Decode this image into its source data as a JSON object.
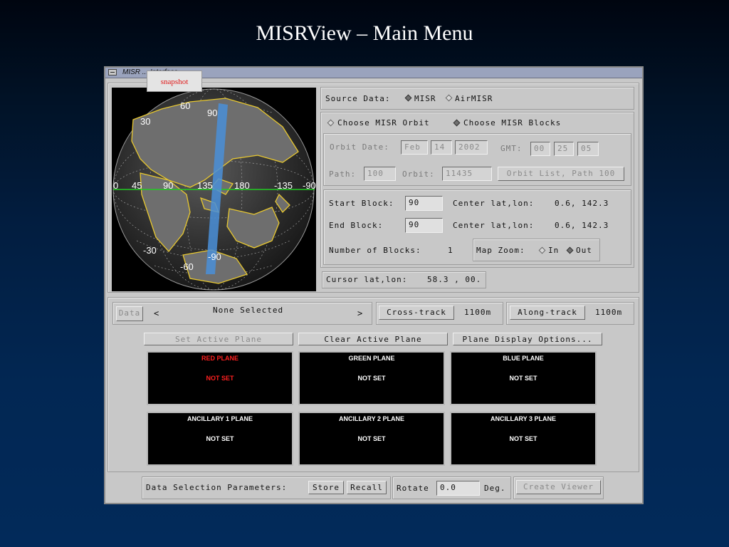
{
  "slide_title": "MISRView – Main Menu",
  "window": {
    "title": "MISR ... Interface",
    "snapshot_label": "snapshot"
  },
  "source_data": {
    "label": "Source Data:",
    "options": [
      "MISR",
      "AirMISR"
    ],
    "selected": "MISR"
  },
  "choose": {
    "orbit_label": "Choose MISR Orbit",
    "blocks_label": "Choose MISR Blocks",
    "selected": "blocks"
  },
  "orbit": {
    "date_label": "Orbit Date:",
    "month": "Feb",
    "day": "14",
    "year": "2002",
    "gmt_label": "GMT:",
    "gmt_h": "00",
    "gmt_m": "25",
    "gmt_s": "05",
    "path_label": "Path:",
    "path": "100",
    "orbit_label": "Orbit:",
    "orbit": "11435",
    "list_button": "Orbit List, Path 100"
  },
  "blocks": {
    "start_label": "Start Block:",
    "start": "90",
    "end_label": "End Block:",
    "end": "90",
    "center_label": "Center lat,lon:",
    "start_center": "0.6, 142.3",
    "end_center": "0.6, 142.3",
    "count_label": "Number of Blocks:",
    "count": "1"
  },
  "map_zoom": {
    "label": "Map Zoom:",
    "in": "In",
    "out": "Out",
    "selected": "out"
  },
  "cursor": {
    "label": "Cursor lat,lon:",
    "value": "58.3 , 00."
  },
  "globe": {
    "lat_labels": [
      "60",
      "30",
      "90",
      "-30",
      "-60",
      "-90"
    ],
    "lon_labels": [
      "0",
      "45",
      "90",
      "135",
      "180",
      "-135",
      "-90"
    ]
  },
  "data_bar": {
    "data_button": "Data",
    "prev": "<",
    "next": ">",
    "selection": "None Selected",
    "cross_track_button": "Cross-track",
    "cross_track_value": "1100m",
    "along_track_button": "Along-track",
    "along_track_value": "1100m"
  },
  "plane_buttons": {
    "set_active": "Set Active Plane",
    "clear_active": "Clear Active Plane",
    "display_options": "Plane Display Options..."
  },
  "planes": [
    {
      "title": "RED PLANE",
      "status": "NOT SET"
    },
    {
      "title": "GREEN PLANE",
      "status": "NOT SET"
    },
    {
      "title": "BLUE PLANE",
      "status": "NOT SET"
    },
    {
      "title": "ANCILLARY 1 PLANE",
      "status": "NOT SET"
    },
    {
      "title": "ANCILLARY 2 PLANE",
      "status": "NOT SET"
    },
    {
      "title": "ANCILLARY 3 PLANE",
      "status": "NOT SET"
    }
  ],
  "bottom": {
    "params_label": "Data Selection Parameters:",
    "store": "Store",
    "recall": "Recall",
    "rotate_label": "Rotate",
    "rotate_value": "0.0",
    "deg_label": "Deg.",
    "create_viewer": "Create Viewer"
  },
  "colors": {
    "swath": "#4a8fd8",
    "equator": "#22cc22",
    "coast": "#e8c830",
    "red_plane": "#ff2020"
  }
}
